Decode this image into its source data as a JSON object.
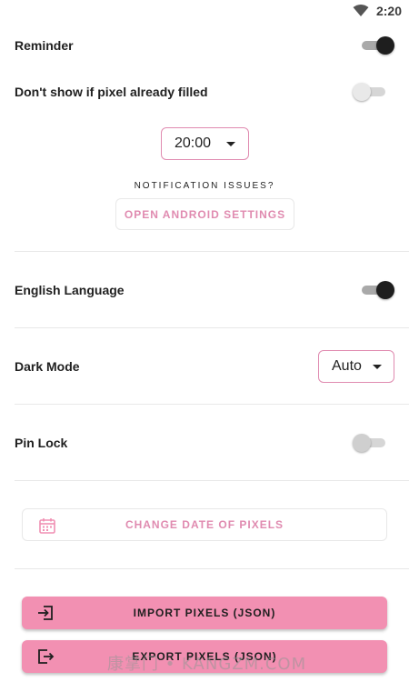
{
  "status_bar": {
    "time": "2:20",
    "wifi_icon": "wifi-icon"
  },
  "reminder": {
    "label": "Reminder",
    "enabled": true
  },
  "dont_show": {
    "label": "Don't show if pixel already filled",
    "enabled": false
  },
  "reminder_time": {
    "value": "20:00"
  },
  "notification": {
    "question": "NOTIFICATION ISSUES?",
    "button_label": "OPEN ANDROID SETTINGS"
  },
  "english_language": {
    "label": "English Language",
    "enabled": true
  },
  "dark_mode": {
    "label": "Dark Mode",
    "value": "Auto"
  },
  "pin_lock": {
    "label": "Pin Lock",
    "enabled": false
  },
  "change_date": {
    "label": "CHANGE DATE OF PIXELS",
    "icon": "calendar-icon"
  },
  "import": {
    "label": "IMPORT PIXELS (JSON)",
    "icon": "import-icon"
  },
  "export": {
    "label": "EXPORT PIXELS (JSON)",
    "icon": "export-icon"
  },
  "watermark": {
    "text": "康掌门 • KANGZM.COM"
  },
  "colors": {
    "accent_pink": "#f290b2",
    "outline_pink": "#e08bb0",
    "switch_on_thumb": "#1e1e1e"
  }
}
